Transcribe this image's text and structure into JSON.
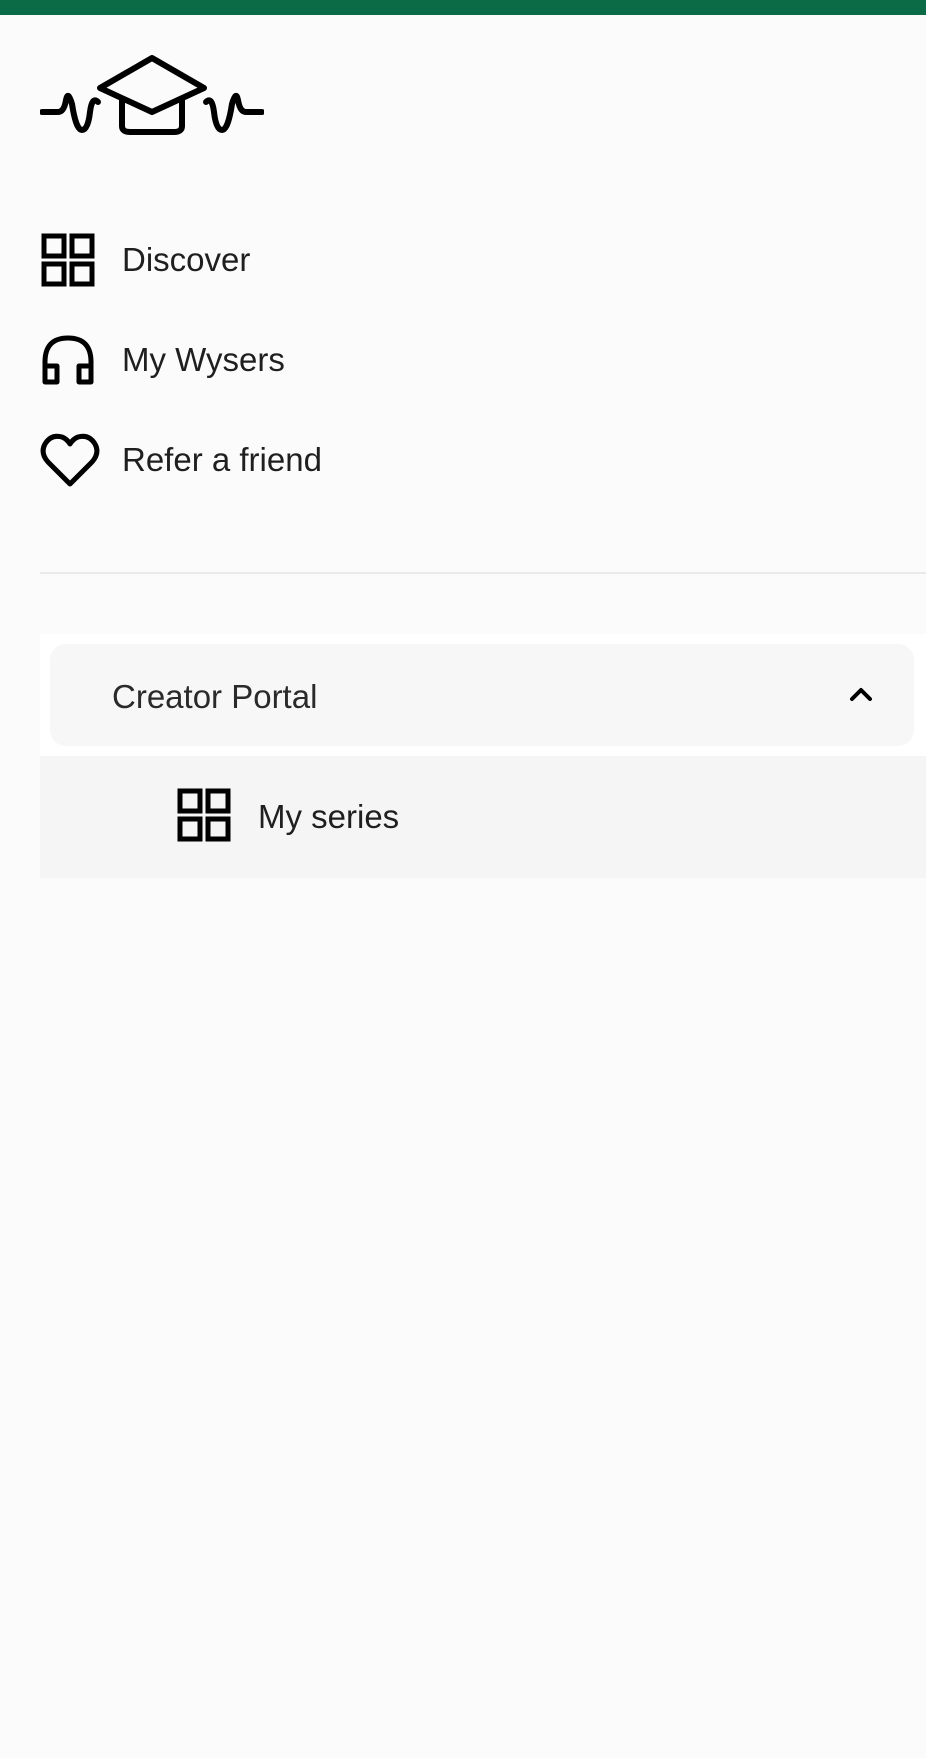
{
  "colors": {
    "topbar": "#0b6b47",
    "background": "#fbfbfc",
    "text": "#1f1f1f"
  },
  "nav": {
    "items": [
      {
        "label": "Discover",
        "icon": "grid-icon"
      },
      {
        "label": "My Wysers",
        "icon": "headphones-icon"
      },
      {
        "label": "Refer a friend",
        "icon": "heart-icon"
      }
    ]
  },
  "creator_portal": {
    "title": "Creator Portal",
    "expanded": true,
    "items": [
      {
        "label": "My series",
        "icon": "grid-icon"
      }
    ]
  }
}
